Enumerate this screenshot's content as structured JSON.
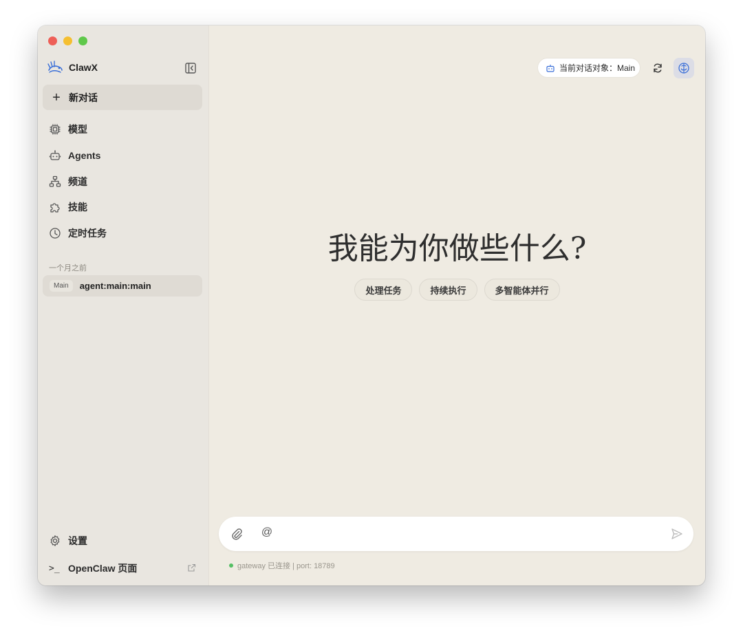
{
  "window": {
    "traffic_lights": [
      "close",
      "minimize",
      "zoom"
    ]
  },
  "sidebar": {
    "brand_name": "ClawX",
    "brand_icon": "lobster-logo-icon",
    "collapse_icon": "sidebar-collapse-icon",
    "new_chat_label": "新对话",
    "nav": [
      {
        "label": "模型",
        "icon": "chip-icon"
      },
      {
        "label": "Agents",
        "icon": "bot-icon"
      },
      {
        "label": "频道",
        "icon": "network-icon"
      },
      {
        "label": "技能",
        "icon": "puzzle-icon"
      },
      {
        "label": "定时任务",
        "icon": "clock-icon"
      }
    ],
    "section_label": "一个月之前",
    "sessions": [
      {
        "badge": "Main",
        "label": "agent:main:main"
      }
    ],
    "settings_label": "设置",
    "openclaw_label": "OpenClaw 页面",
    "openclaw_glyph": ">_"
  },
  "header": {
    "target_label": "当前对话对象：Main",
    "refresh_icon": "refresh-icon",
    "brain_icon": "brain-icon"
  },
  "hero": {
    "title": "我能为你做些什么?",
    "chips": [
      "处理任务",
      "持续执行",
      "多智能体并行"
    ]
  },
  "composer": {
    "placeholder": "",
    "mention_glyph": "@"
  },
  "status": {
    "text": "gateway 已连接 | port: 18789",
    "color": "#55bf64"
  },
  "colors": {
    "background": "#efebe2",
    "sidebar": "#e9e6e0",
    "accent": "#3a6fd8"
  }
}
